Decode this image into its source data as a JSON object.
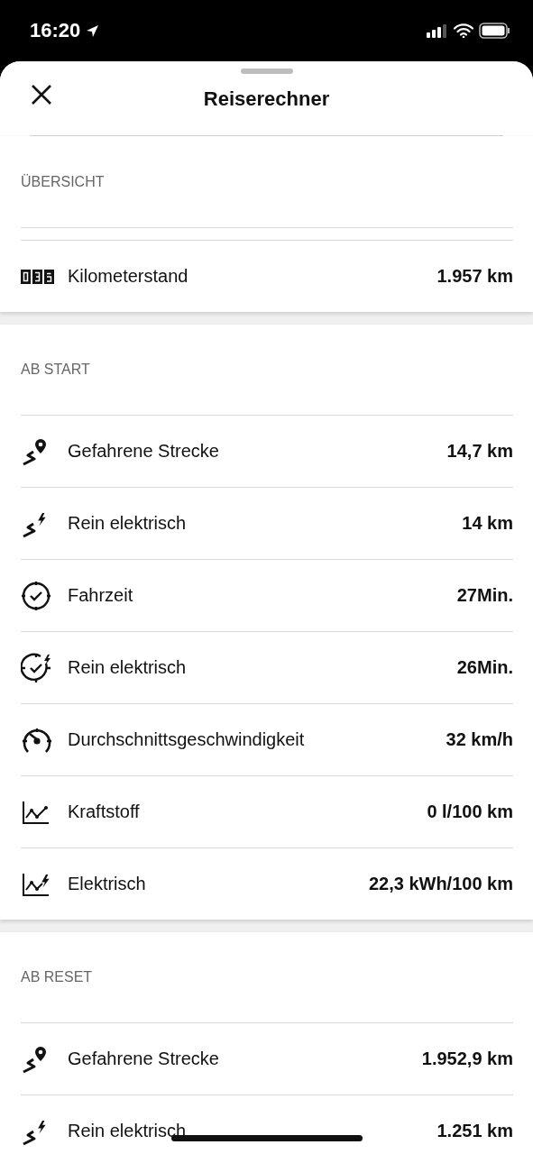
{
  "status_bar": {
    "time": "16:20"
  },
  "sheet": {
    "title": "Reiserechner"
  },
  "sections": [
    {
      "title": "ÜBERSICHT",
      "rows": [
        {
          "kind": "odometer",
          "label": "Kilometerstand",
          "value": "1.957 km"
        }
      ]
    },
    {
      "title": "AB START",
      "rows": [
        {
          "kind": "route",
          "label": "Gefahrene Strecke",
          "value": "14,7 km"
        },
        {
          "kind": "route-electric",
          "label": "Rein elektrisch",
          "value": "14 km"
        },
        {
          "kind": "clock",
          "label": "Fahrzeit",
          "value": "27Min."
        },
        {
          "kind": "clock-electric",
          "label": "Rein elektrisch",
          "value": "26Min."
        },
        {
          "kind": "gauge",
          "label": "Durchschnittsgeschwindigkeit",
          "value": "32 km/h"
        },
        {
          "kind": "chart",
          "label": "Kraftstoff",
          "value": "0 l/100 km"
        },
        {
          "kind": "chart-electric",
          "label": "Elektrisch",
          "value": "22,3 kWh/100 km"
        }
      ]
    },
    {
      "title": "AB RESET",
      "rows": [
        {
          "kind": "route",
          "label": "Gefahrene Strecke",
          "value": "1.952,9 km"
        },
        {
          "kind": "route-electric",
          "label": "Rein elektrisch",
          "value": "1.251 km"
        }
      ]
    }
  ]
}
